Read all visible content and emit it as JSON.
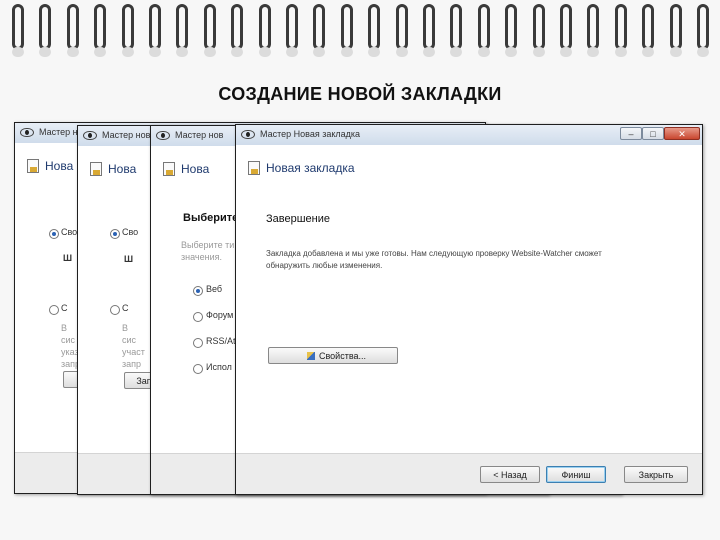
{
  "slide": {
    "title": "СОЗДАНИЕ НОВОЙ ЗАКЛАДКИ"
  },
  "dialogs": [
    {
      "window_title": "Мастер нов",
      "header_title": "Нова",
      "options": [
        "Сво",
        "С"
      ],
      "field": "Ш",
      "lines": [
        "В",
        "сис",
        "указ",
        "запр"
      ],
      "button": "З"
    },
    {
      "window_title": "Мастер нов",
      "header_title": "Нова",
      "options": [
        "Сво",
        "С"
      ],
      "field": "Ш",
      "lines": [
        "В",
        "сис",
        "участ",
        "запр"
      ],
      "button": "Зап"
    },
    {
      "window_title": "Мастер нов",
      "header_title": "Нова",
      "subtitle": "Выберите",
      "desc_lines": [
        "Выберите ти",
        "значения."
      ],
      "options": [
        "Веб",
        "Форум",
        "RSS/Ato",
        "Испол"
      ]
    },
    {
      "window_title": "Мастер Новая закладка",
      "header_title": "Новая закладка",
      "subtitle": "Завершение",
      "message_line1": "Закладка добавлена и мы уже готовы. Нам следующую проверку Website-Watcher сможет",
      "message_line2": "обнаружить любые изменения.",
      "properties_button": "Свойства...",
      "back_button": "< Назад",
      "finish_button": "Финиш",
      "close_button": "Закрыть",
      "win_minimize": "–",
      "win_maximize": "□",
      "win_close": "✕"
    }
  ],
  "icons": {
    "window_icon": "eye-icon",
    "header_icon": "bookmark-page-icon",
    "properties_icon": "pencil-icon"
  }
}
